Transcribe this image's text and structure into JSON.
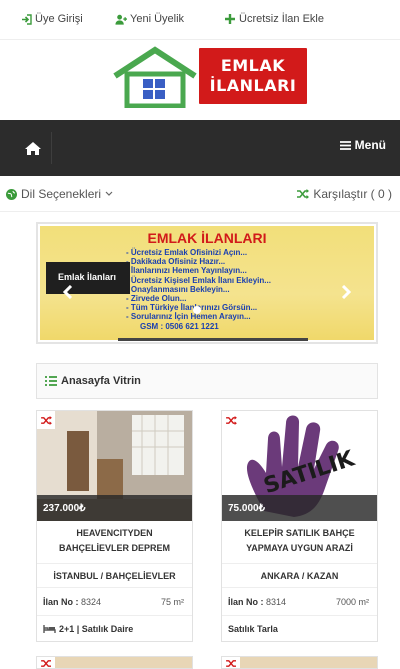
{
  "topbar": {
    "login": "Üye Girişi",
    "register": "Yeni Üyelik",
    "add_listing": "Ücretsiz İlan Ekle"
  },
  "logo": {
    "line1": "EMLAK",
    "line2": "İLANLARI"
  },
  "nav": {
    "menu_label": "Menü"
  },
  "options": {
    "language": "Dil Seçenekleri",
    "compare": "Karşılaştır ( 0 )"
  },
  "slider": {
    "title": "EMLAK İLANLARI",
    "caption": "Emlak İlanları",
    "lines": [
      "- Ücretsiz Emlak Ofisinizi Açın...",
      "- Dakikada Ofisiniz Hazır...",
      "- İlanlarınızı Hemen Yayınlayın...",
      "- Ücretsiz Kişisel Emlak İlanı Ekleyin...",
      "- Onaylanmasını Bekleyin...",
      "- Zirvede Olun...",
      "- Tüm Türkiye İlanlarınızı Görsün...",
      "- Sorularınız İçin Hemen Arayın...",
      "GSM : 0506 621 1221"
    ]
  },
  "section": {
    "title": "Anasayfa Vitrin"
  },
  "listings": [
    {
      "price": "237.000₺",
      "title_line1": "HEAVENCITYDEN",
      "title_line2": "BAHÇELİEVLER DEPREM",
      "location": "İSTANBUL / BAHÇELİEVLER",
      "ilan_label": "İlan No :",
      "ilan_no": "8324",
      "area": "75 m²",
      "type": "2+1 | Satılık Daire"
    },
    {
      "price": "75.000₺",
      "title_line1": "KELEPİR SATILIK BAHÇE",
      "title_line2": "YAPMAYA UYGUN ARAZİ",
      "location": "ANKARA / KAZAN",
      "ilan_label": "İlan No :",
      "ilan_no": "8314",
      "area": "7000 m²",
      "type": "Satılık Tarla"
    }
  ],
  "colors": {
    "nav_bg": "#2c2c2c",
    "logo_red": "#d21a1a",
    "logo_green": "#4aa84f",
    "accent_green": "#3b9b3b"
  }
}
